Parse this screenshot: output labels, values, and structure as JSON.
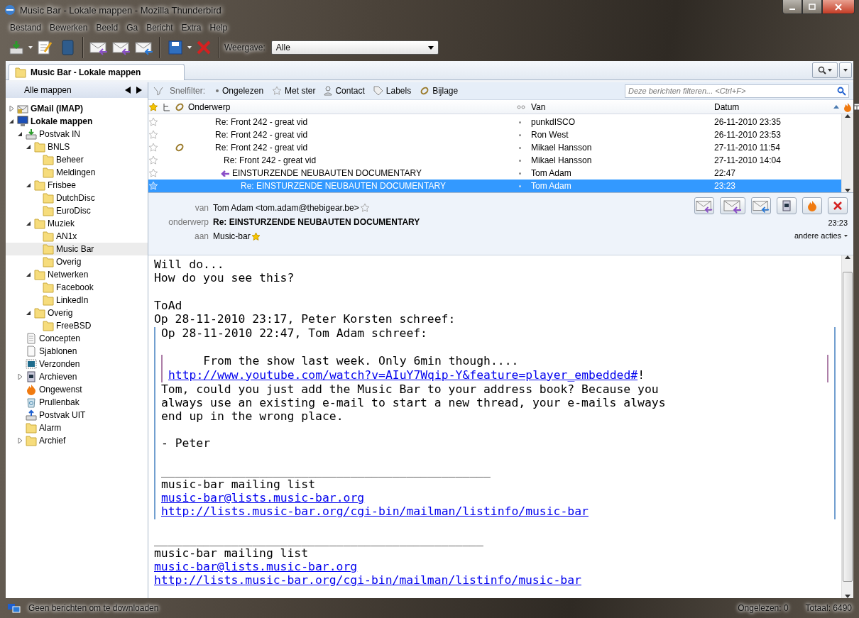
{
  "window": {
    "title": "Music Bar - Lokale mappen - Mozilla Thunderbird"
  },
  "menu": [
    "Bestand",
    "Bewerken",
    "Beeld",
    "Ga",
    "Bericht",
    "Extra",
    "Help"
  ],
  "toolbar": {
    "view_label": "Weergave:",
    "view_value": "Alle"
  },
  "tab": {
    "label": "Music Bar - Lokale mappen"
  },
  "folder_pane": {
    "header": "Alle mappen",
    "folders": [
      {
        "name": "GMail (IMAP)",
        "kind": "account",
        "bold": true,
        "expanded": false,
        "selected": false
      },
      {
        "name": "Lokale mappen",
        "kind": "local",
        "bold": true,
        "expanded": true,
        "selected": false,
        "children": [
          {
            "name": "Postvak IN",
            "kind": "inbox",
            "bold": false,
            "expanded": true,
            "selected": false,
            "children": [
              {
                "name": "BNLS",
                "kind": "folder",
                "bold": false,
                "expanded": true,
                "selected": false,
                "children": [
                  {
                    "name": "Beheer",
                    "kind": "folder",
                    "bold": false,
                    "selected": false
                  },
                  {
                    "name": "Meldingen",
                    "kind": "folder",
                    "bold": false,
                    "selected": false
                  }
                ]
              },
              {
                "name": "Frisbee",
                "kind": "folder",
                "bold": false,
                "expanded": true,
                "selected": false,
                "children": [
                  {
                    "name": "DutchDisc",
                    "kind": "folder",
                    "bold": false,
                    "selected": false
                  },
                  {
                    "name": "EuroDisc",
                    "kind": "folder",
                    "bold": false,
                    "selected": false
                  }
                ]
              },
              {
                "name": "Muziek",
                "kind": "folder",
                "bold": false,
                "expanded": true,
                "selected": false,
                "children": [
                  {
                    "name": "AN1x",
                    "kind": "folder",
                    "bold": false,
                    "selected": false
                  },
                  {
                    "name": "Music Bar",
                    "kind": "folder",
                    "bold": false,
                    "selected": true
                  },
                  {
                    "name": "Overig",
                    "kind": "folder",
                    "bold": false,
                    "selected": false
                  }
                ]
              },
              {
                "name": "Netwerken",
                "kind": "folder",
                "bold": false,
                "expanded": true,
                "selected": false,
                "children": [
                  {
                    "name": "Facebook",
                    "kind": "folder",
                    "bold": false,
                    "selected": false
                  },
                  {
                    "name": "LinkedIn",
                    "kind": "folder",
                    "bold": false,
                    "selected": false
                  }
                ]
              },
              {
                "name": "Overig",
                "kind": "folder",
                "bold": false,
                "expanded": true,
                "selected": false,
                "children": [
                  {
                    "name": "FreeBSD",
                    "kind": "folder",
                    "bold": false,
                    "selected": false
                  }
                ]
              }
            ]
          },
          {
            "name": "Concepten",
            "kind": "drafts",
            "bold": false,
            "selected": false
          },
          {
            "name": "Sjablonen",
            "kind": "templates",
            "bold": false,
            "selected": false
          },
          {
            "name": "Verzonden",
            "kind": "sent",
            "bold": false,
            "selected": false
          },
          {
            "name": "Archieven",
            "kind": "archives",
            "bold": false,
            "expanded": false,
            "selected": false
          },
          {
            "name": "Ongewenst",
            "kind": "junk",
            "bold": false,
            "selected": false
          },
          {
            "name": "Prullenbak",
            "kind": "trash",
            "bold": false,
            "selected": false
          },
          {
            "name": "Postvak UIT",
            "kind": "outbox",
            "bold": false,
            "selected": false
          },
          {
            "name": "Alarm",
            "kind": "folder",
            "bold": false,
            "selected": false
          },
          {
            "name": "Archief",
            "kind": "folder",
            "bold": false,
            "expanded": false,
            "selected": false
          }
        ]
      }
    ]
  },
  "quick_filter": {
    "label": "Snelfilter:",
    "items": [
      {
        "label": "Ongelezen",
        "kind": "unread"
      },
      {
        "label": "Met ster",
        "kind": "starred"
      },
      {
        "label": "Contact",
        "kind": "contact"
      },
      {
        "label": "Labels",
        "kind": "tags"
      },
      {
        "label": "Bijlage",
        "kind": "attachment"
      }
    ],
    "placeholder": "Deze berichten filteren... <Ctrl+F>"
  },
  "message_list": {
    "columns": {
      "subject": "Onderwerp",
      "from": "Van",
      "date": "Datum"
    },
    "rows": [
      {
        "subject": "Re: Front 242 - great vid",
        "from": "punkdISCO",
        "date": "26-11-2010 23:35",
        "starred": false,
        "attachment": false,
        "replied": false,
        "selected": false
      },
      {
        "subject": "Re: Front 242 - great vid",
        "from": "Ron West",
        "date": "26-11-2010 23:53",
        "starred": false,
        "attachment": false,
        "replied": false,
        "selected": false
      },
      {
        "subject": "Re: Front 242 - great vid",
        "from": "Mikael Hansson",
        "date": "27-11-2010 11:54",
        "starred": false,
        "attachment": true,
        "replied": false,
        "selected": false,
        "children": [
          {
            "subject": "Re: Front 242 - great vid",
            "from": "Mikael Hansson",
            "date": "27-11-2010 14:04",
            "starred": false,
            "attachment": false,
            "replied": false,
            "selected": false,
            "children": [
              {
                "subject": "EINSTURZENDE NEUBAUTEN DOCUMENTARY",
                "from": "Tom Adam",
                "date": "22:47",
                "starred": false,
                "attachment": false,
                "replied": true,
                "selected": false,
                "children": [
                  {
                    "subject": "Re: EINSTURZENDE NEUBAUTEN DOCUMENTARY",
                    "from": "Tom Adam",
                    "date": "23:23",
                    "starred": false,
                    "attachment": false,
                    "replied": false,
                    "selected": true
                  }
                ]
              }
            ]
          }
        ]
      }
    ]
  },
  "message_header": {
    "from_label": "van",
    "from": "Tom Adam <tom.adam@thebigear.be>",
    "subject_label": "onderwerp",
    "subject": "Re: EINSTURZENDE NEUBAUTEN DOCUMENTARY",
    "time": "23:23",
    "to_label": "aan",
    "to": "Music-bar",
    "other_actions": "andere acties"
  },
  "message_body": [
    {
      "kind": "text",
      "text": "Will do..."
    },
    {
      "kind": "text",
      "text": "How do you see this?"
    },
    {
      "kind": "gap"
    },
    {
      "kind": "text",
      "text": "ToAd"
    },
    {
      "kind": "text",
      "text": "Op 28-11-2010 23:17, Peter Korsten schreef:"
    },
    {
      "kind": "quote",
      "children": [
        {
          "kind": "text",
          "text": "Op 28-11-2010 22:47, Tom Adam schreef:"
        },
        {
          "kind": "gap"
        },
        {
          "kind": "quote",
          "children": [
            {
              "kind": "text",
              "text": "     From the show last week. Only 6min though...."
            },
            {
              "kind": "link",
              "text": "http://www.youtube.com/watch?v=AIuY7Wqip-Y&feature=player_embedded#",
              "after": "!"
            }
          ]
        },
        {
          "kind": "text",
          "text": "Tom, could you just add the Music Bar to your address book? Because you"
        },
        {
          "kind": "text",
          "text": "always use an existing e-mail to start a new thread, your e-mails always"
        },
        {
          "kind": "text",
          "text": "end up in the wrong place."
        },
        {
          "kind": "gap"
        },
        {
          "kind": "text",
          "text": "- Peter"
        },
        {
          "kind": "gap"
        },
        {
          "kind": "text",
          "text": "_______________________________________________"
        },
        {
          "kind": "text",
          "text": "music-bar mailing list"
        },
        {
          "kind": "link",
          "text": "music-bar@lists.music-bar.org"
        },
        {
          "kind": "link",
          "text": "http://lists.music-bar.org/cgi-bin/mailman/listinfo/music-bar"
        }
      ]
    },
    {
      "kind": "gap"
    },
    {
      "kind": "text",
      "text": "_______________________________________________"
    },
    {
      "kind": "text",
      "text": "music-bar mailing list"
    },
    {
      "kind": "link",
      "text": "music-bar@lists.music-bar.org"
    },
    {
      "kind": "link",
      "text": "http://lists.music-bar.org/cgi-bin/mailman/listinfo/music-bar"
    }
  ],
  "status_bar": {
    "message": "Geen berichten om te downloaden",
    "unread": "Ongelezen: 0",
    "total": "Totaal: 6490"
  }
}
